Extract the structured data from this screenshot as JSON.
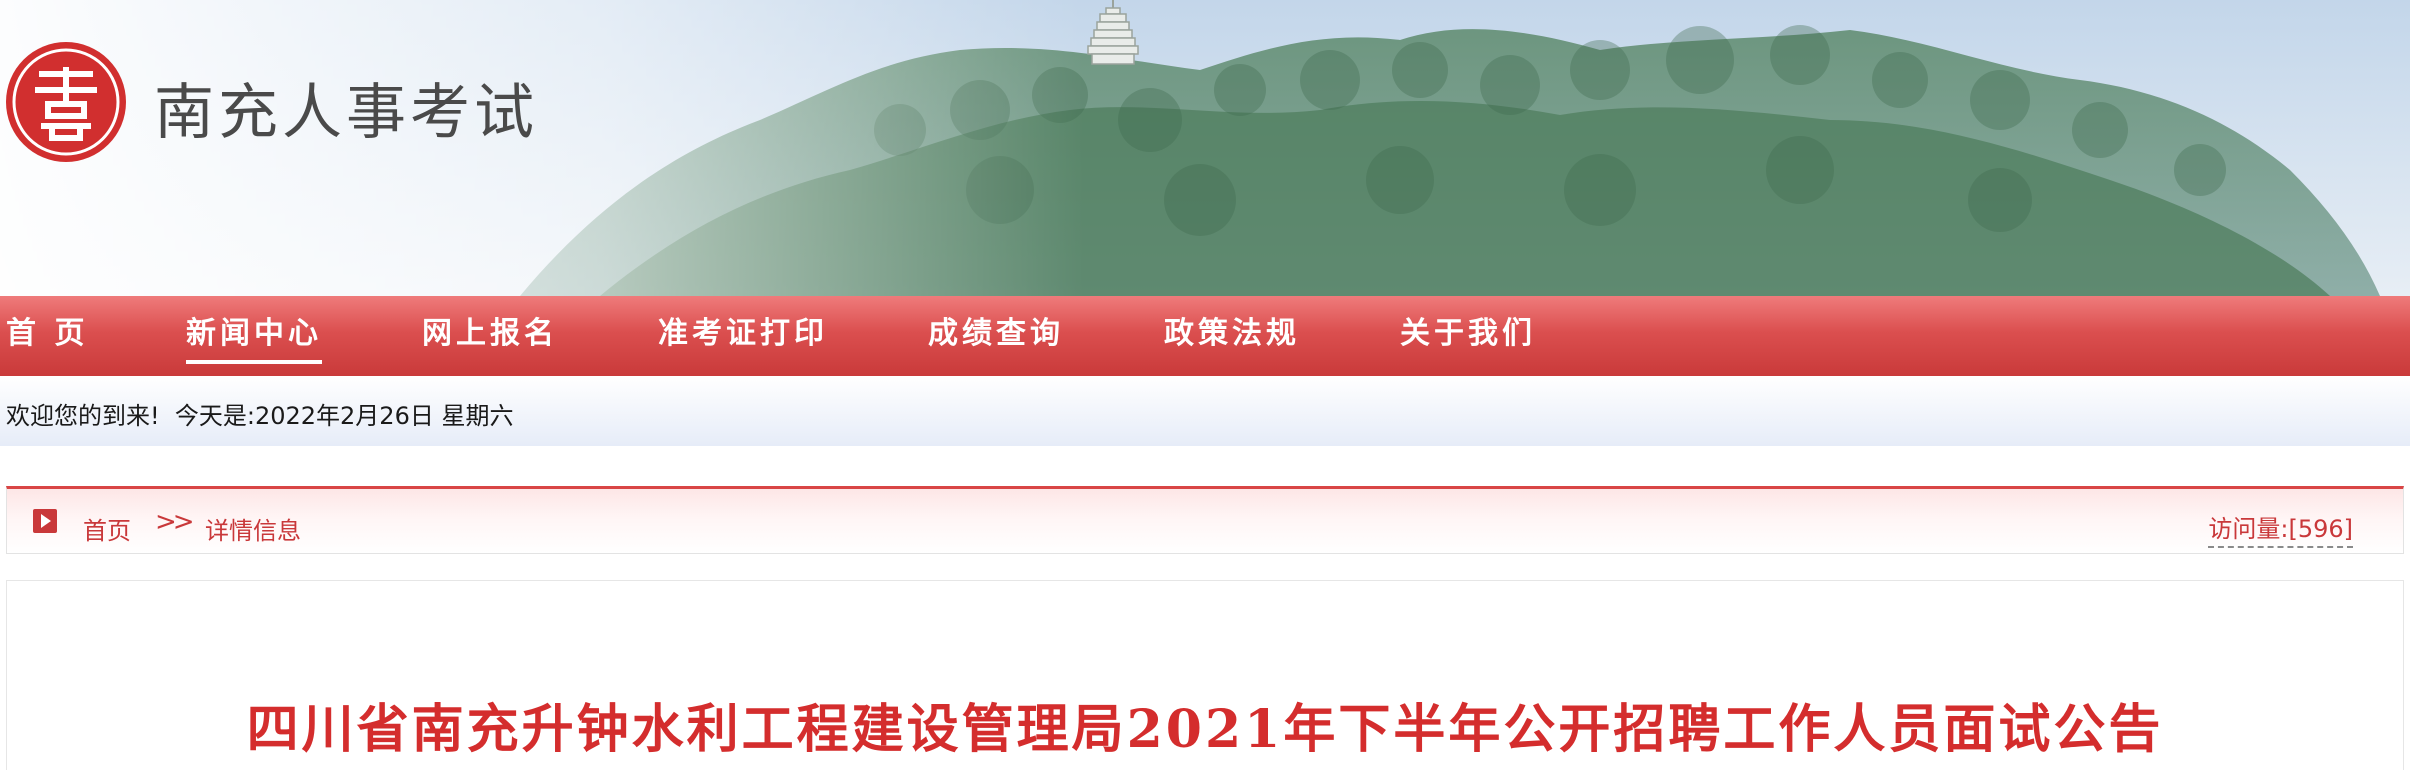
{
  "header": {
    "site_title": "南充人事考试",
    "logo_icon": "seal-logo-icon"
  },
  "nav": {
    "items": [
      {
        "label": "首 页",
        "active": false
      },
      {
        "label": "新闻中心",
        "active": true
      },
      {
        "label": "网上报名",
        "active": false
      },
      {
        "label": "准考证打印",
        "active": false
      },
      {
        "label": "成绩查询",
        "active": false
      },
      {
        "label": "政策法规",
        "active": false
      },
      {
        "label": "关于我们",
        "active": false
      }
    ]
  },
  "welcome": {
    "text": "欢迎您的到来!  今天是:2022年2月26日 星期六"
  },
  "breadcrumb": {
    "home": "首页",
    "separator": ">>",
    "current": "详情信息"
  },
  "visits": {
    "label": "访问量:[596]"
  },
  "article": {
    "title": "四川省南充升钟水利工程建设管理局2021年下半年公开招聘工作人员面试公告"
  },
  "colors": {
    "accent": "#d94545",
    "title_red": "#d42d2d",
    "nav_dark": "#c93a3a"
  }
}
